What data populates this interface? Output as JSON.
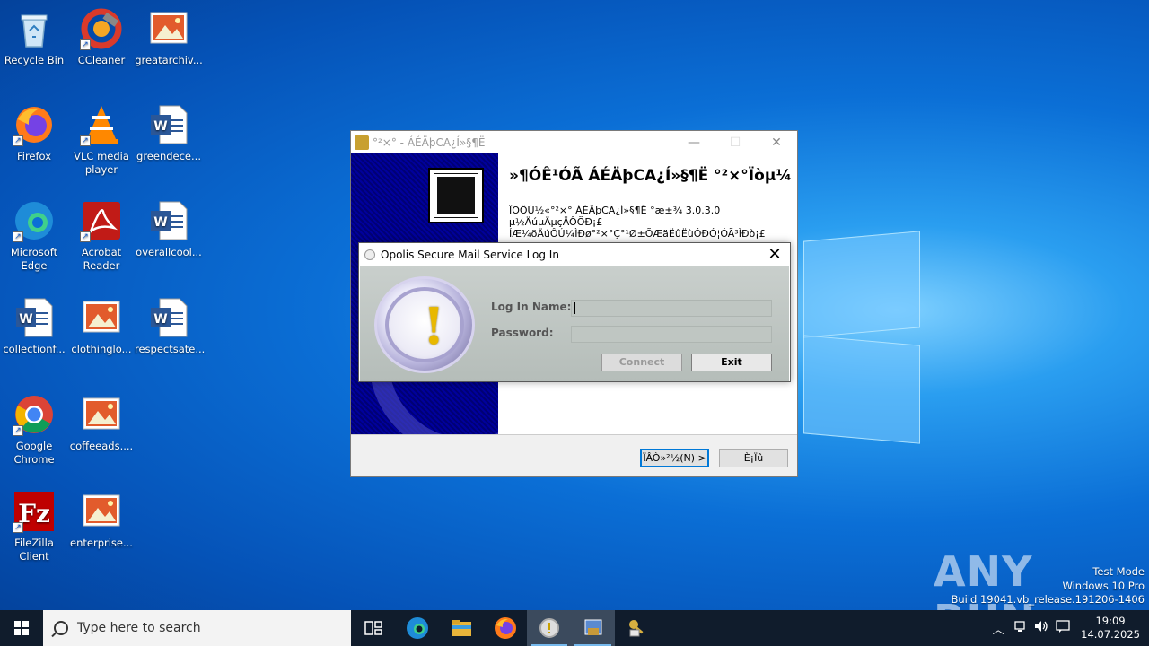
{
  "desktop": {
    "icons": [
      {
        "label": "Recycle Bin",
        "icon": "recycle-bin-icon"
      },
      {
        "label": "CCleaner",
        "icon": "ccleaner-icon"
      },
      {
        "label": "greatarchiv...",
        "icon": "image-file-icon"
      },
      {
        "label": "Firefox",
        "icon": "firefox-icon"
      },
      {
        "label": "VLC media player",
        "icon": "vlc-icon"
      },
      {
        "label": "greendece...",
        "icon": "word-doc-icon"
      },
      {
        "label": "Microsoft Edge",
        "icon": "edge-icon"
      },
      {
        "label": "Acrobat Reader",
        "icon": "acrobat-icon"
      },
      {
        "label": "overallcool...",
        "icon": "word-doc-icon"
      },
      {
        "label": "collectionf...",
        "icon": "word-doc-icon"
      },
      {
        "label": "clothinglo...",
        "icon": "image-file-icon"
      },
      {
        "label": "respectsate...",
        "icon": "word-doc-icon"
      },
      {
        "label": "Google Chrome",
        "icon": "chrome-icon"
      },
      {
        "label": "coffeeads....",
        "icon": "image-file-icon"
      },
      {
        "label": "FileZilla Client",
        "icon": "filezilla-icon"
      },
      {
        "label": "enterprise...",
        "icon": "image-file-icon"
      }
    ],
    "watermark": "ANY RUN",
    "test_mode": [
      "Test Mode",
      "Windows 10 Pro",
      "Build 19041.vb_release.191206-1406"
    ]
  },
  "installer": {
    "title": "°²×° - ÁÉÄþCA¿Í»§¶Ë",
    "heading": "»¶Ó­Ê¹ÓÃ ÁÉÄþCA¿Í»§¶Ë °²×°Ïòµ¼",
    "text1": "ÏÖÔÚ½«°²×° ÁÉÄþCA¿Í»§¶Ë °æ±¾ 3.0.3.0 µ½ÄúµÄµçÄÔÖÐ¡£",
    "text2": "ÍÆ¼öÄúÔÚ¼ÌÐø°²×°Ç°¹Ø±ÕÆäËûËùÓÐÓ¦ÓÃ³ÌÐò¡£",
    "next_label": "ÏÂÒ»²½(N) >",
    "cancel_label": "È¡Ïû",
    "controls": {
      "minimize": "—",
      "maximize": "☐",
      "close": "✕"
    }
  },
  "login": {
    "title": "Opolis Secure Mail Service Log In",
    "close": "✕",
    "name_label": "Log In Name:",
    "password_label": "Password:",
    "name_value": "",
    "password_value": "",
    "connect_label": "Connect",
    "exit_label": "Exit"
  },
  "taskbar": {
    "search_placeholder": "Type here to search",
    "apps": [
      "task-view-icon",
      "edge-icon",
      "file-explorer-icon",
      "firefox-icon",
      "login-app-icon",
      "installer-icon",
      "setup-keys-icon"
    ],
    "time": "19:09",
    "date": "14.07.2025"
  }
}
